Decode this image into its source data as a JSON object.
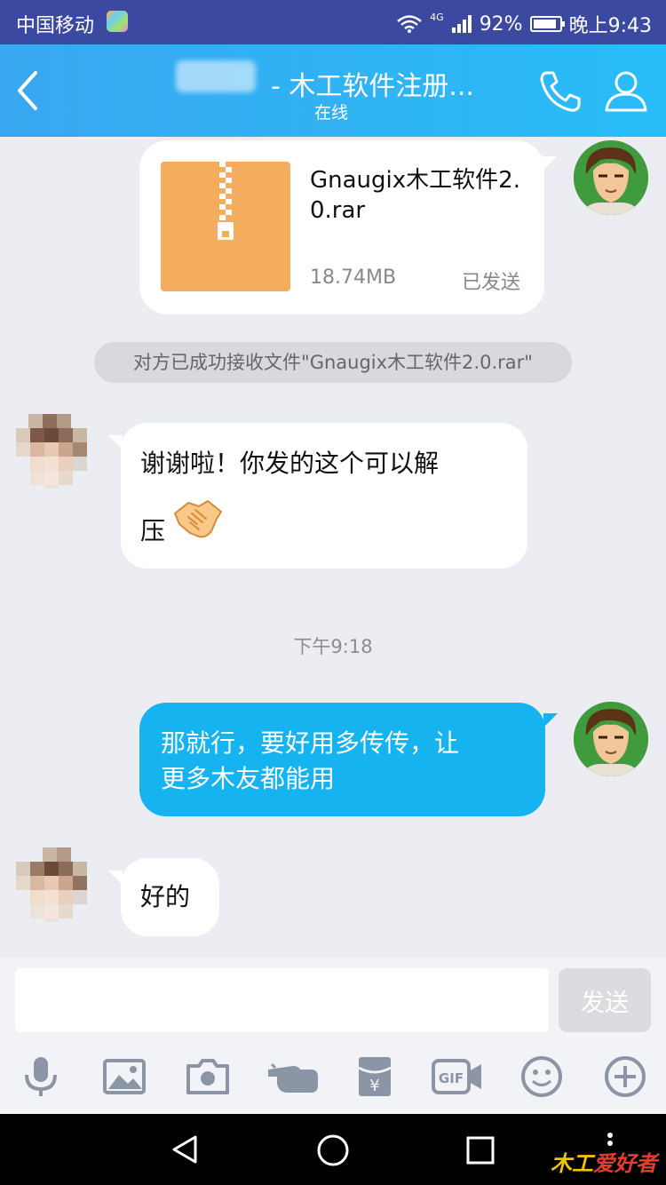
{
  "status_bar": {
    "carrier": "中国移动",
    "network": "4G",
    "battery": "92%",
    "battery_level": 0.92,
    "time": "晚上9:43"
  },
  "header": {
    "title": "- 木工软件注册...",
    "status": "在线"
  },
  "messages": {
    "file": {
      "name": "Gnaugix木工软件2.0.rar",
      "size": "18.74MB",
      "status": "已发送"
    },
    "notice": "对方已成功接收文件\"Gnaugix木工软件2.0.rar\"",
    "incoming_1": {
      "text_line1": "谢谢啦！你发的这个可以解",
      "text_line2": "压",
      "emoji": "handshake-emoji"
    },
    "timestamp": "下午9:18",
    "outgoing_1": {
      "line1": "那就行，要好用多传传，让",
      "line2": "更多木友都能用"
    },
    "incoming_2": "好的"
  },
  "input": {
    "placeholder": "",
    "send_label": "发送"
  },
  "toolbar": [
    "microphone-icon",
    "image-icon",
    "camera-icon",
    "poke-hand-icon",
    "red-packet-icon",
    "gif-icon",
    "emoji-icon",
    "add-icon"
  ],
  "navbar": {
    "watermark_part1": "木工",
    "watermark_part2": "爱好者"
  },
  "colors": {
    "header": "#28bdf8",
    "outgoing_bubble": "#15b4f1",
    "file_icon": "#f4ac5e"
  }
}
